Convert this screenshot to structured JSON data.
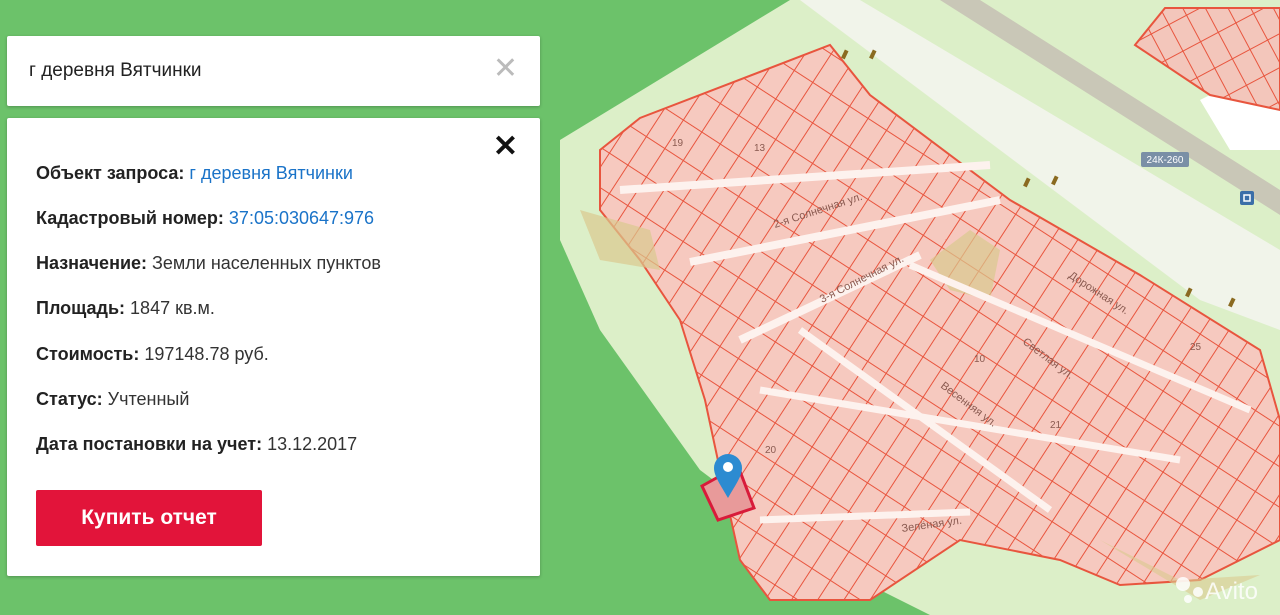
{
  "search": {
    "query": "г деревня Вятчинки"
  },
  "info": {
    "rows": [
      {
        "label": "Объект запроса:",
        "value": "г деревня Вятчинки"
      },
      {
        "label": "Кадастровый номер:",
        "value": "37:05:030647:976"
      },
      {
        "label": "Назначение:",
        "value": "Земли населенных пунктов"
      },
      {
        "label": "Площадь:",
        "value": "1847 кв.м."
      },
      {
        "label": "Стоимость:",
        "value": "197148.78 руб."
      },
      {
        "label": "Статус:",
        "value": "Учтенный"
      },
      {
        "label": "Дата постановки на учет:",
        "value": "13.12.2017"
      }
    ],
    "buy_label": "Купить отчет"
  },
  "map": {
    "road_badge": "24К-260",
    "streets": {
      "s1": "2-я Солнечная ул.",
      "s2": "3-я Солнечная ул.",
      "s3": "Дорожная ул.",
      "s4": "Светлая ул.",
      "s5": "Весенняя ул.",
      "s6": "Зелёная ул."
    },
    "numbers": {
      "n1": "19",
      "n2": "13",
      "n3": "25",
      "n4": "10",
      "n5": "21",
      "n6": "20"
    },
    "watermark": "Avito",
    "colors": {
      "forest": "#6cc26a",
      "parcel_fill": "#f6c9bf",
      "parcel_line": "#e8553e",
      "accent_red": "#e2143a",
      "link_blue": "#1a73c8"
    }
  }
}
